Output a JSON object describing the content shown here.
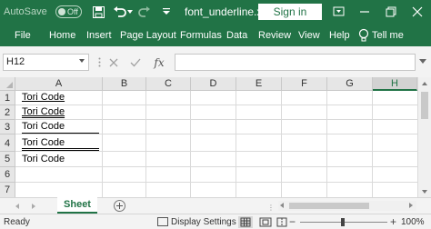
{
  "titlebar": {
    "autosave_label": "AutoSave",
    "autosave_state": "Off",
    "doc_title": "font_underline.x...",
    "signin_label": "Sign in",
    "icons": [
      "save-icon",
      "undo-icon",
      "redo-icon",
      "customize-qat-icon",
      "ribbon-display-icon",
      "minimize-icon",
      "restore-icon",
      "close-icon"
    ]
  },
  "ribbon": {
    "tabs": [
      "File",
      "Home",
      "Insert",
      "Page Layout",
      "Formulas",
      "Data",
      "Review",
      "View",
      "Help"
    ],
    "tellme_label": "Tell me",
    "color": "#217346"
  },
  "formula_bar": {
    "name_box": "H12",
    "fx_label": "fx",
    "formula": "",
    "icons": [
      "cancel-icon",
      "enter-icon",
      "insert-function-icon"
    ]
  },
  "grid": {
    "columns": [
      "A",
      "B",
      "C",
      "D",
      "E",
      "F",
      "G",
      "H"
    ],
    "selected_column": "H",
    "rows": [
      "1",
      "2",
      "3",
      "4",
      "5",
      "6",
      "7"
    ],
    "cells": [
      {
        "row": "1",
        "col": "A",
        "text": "Tori Code",
        "underline": "single"
      },
      {
        "row": "2",
        "col": "A",
        "text": "Tori Code",
        "underline": "double"
      },
      {
        "row": "3",
        "col": "A",
        "text": "Tori Code",
        "underline": "single-accounting"
      },
      {
        "row": "4",
        "col": "A",
        "text": "Tori Code",
        "underline": "double-accounting"
      },
      {
        "row": "5",
        "col": "A",
        "text": "Tori Code",
        "underline": "none"
      }
    ]
  },
  "sheets": {
    "tabs": [
      "Sheet"
    ],
    "active": "Sheet"
  },
  "status": {
    "ready": "Ready",
    "display_settings": "Display Settings",
    "zoom": "100%",
    "zoom_level": 1.0
  }
}
